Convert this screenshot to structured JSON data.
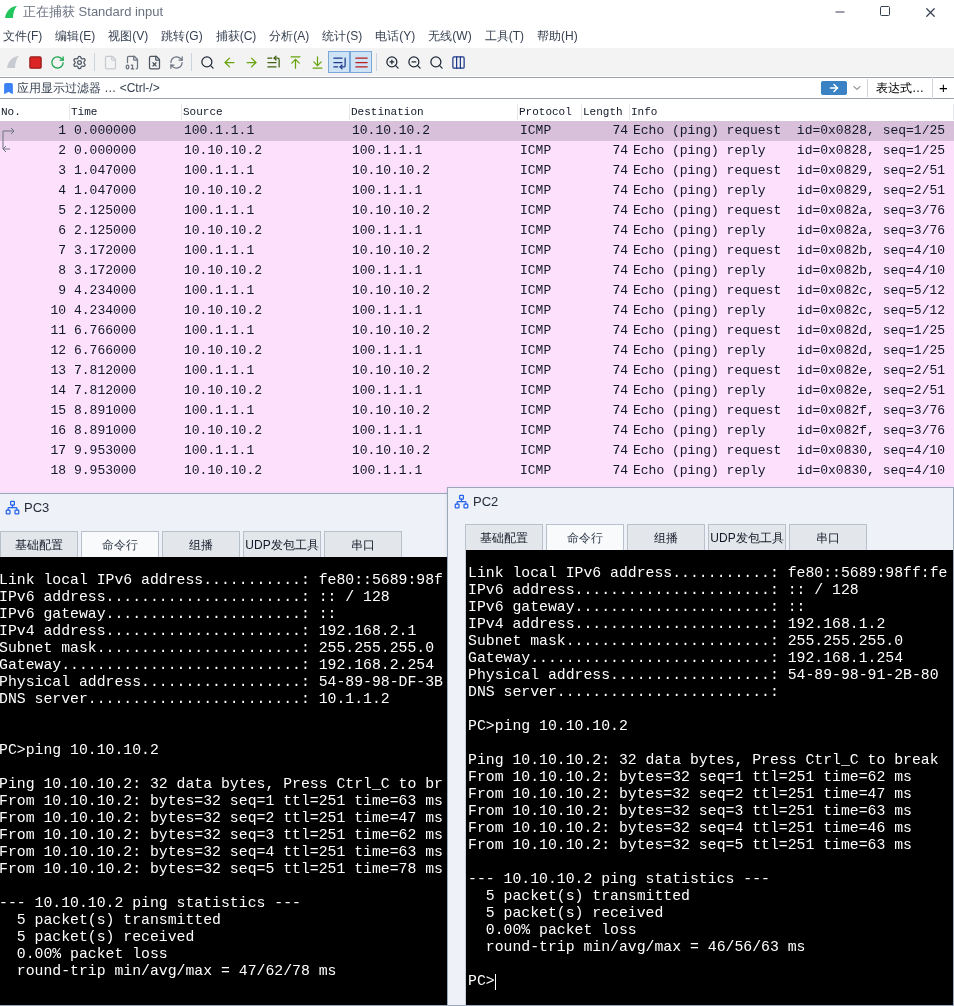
{
  "window": {
    "title": "正在捕获 Standard input"
  },
  "menu": [
    "文件(F)",
    "编辑(E)",
    "视图(V)",
    "跳转(G)",
    "捕获(C)",
    "分析(A)",
    "统计(S)",
    "电话(Y)",
    "无线(W)",
    "工具(T)",
    "帮助(H)"
  ],
  "toolbar": [
    {
      "on": false,
      "disabled": true
    },
    {
      "on": false,
      "disabled": false
    },
    {
      "on": false,
      "disabled": false
    },
    {
      "on": false,
      "disabled": false
    },
    {
      "on": false,
      "disabled": true
    },
    {
      "on": false,
      "disabled": false
    },
    {
      "on": false,
      "disabled": false
    },
    {
      "on": false,
      "disabled": false
    },
    {
      "on": false,
      "disabled": false
    },
    {
      "on": false,
      "disabled": false
    },
    {
      "on": false,
      "disabled": false
    },
    {
      "on": false,
      "disabled": false
    },
    {
      "on": false,
      "disabled": false
    },
    {
      "on": false,
      "disabled": false
    },
    {
      "on": true,
      "disabled": false
    },
    {
      "on": true,
      "disabled": false
    },
    {
      "on": false,
      "disabled": false
    },
    {
      "on": false,
      "disabled": false
    },
    {
      "on": false,
      "disabled": false
    },
    {
      "on": false,
      "disabled": false
    }
  ],
  "filter": {
    "placeholder": "应用显示过滤器 … <Ctrl-/>",
    "expression": "表达式…",
    "add": "+"
  },
  "table": {
    "columns": [
      "No.",
      "Time",
      "Source",
      "Destination",
      "Protocol",
      "Length",
      "Info"
    ],
    "rows": [
      {
        "cells": [
          "1",
          "0.000000",
          "100.1.1.1",
          "10.10.10.2",
          "ICMP",
          "74",
          "Echo (ping) request  id=0x0828, seq=1/25"
        ],
        "selected": true,
        "kind": "request"
      },
      {
        "cells": [
          "2",
          "0.000000",
          "10.10.10.2",
          "100.1.1.1",
          "ICMP",
          "74",
          "Echo (ping) reply    id=0x0828, seq=1/25"
        ],
        "selected": false,
        "kind": "reply"
      },
      {
        "cells": [
          "3",
          "1.047000",
          "100.1.1.1",
          "10.10.10.2",
          "ICMP",
          "74",
          "Echo (ping) request  id=0x0829, seq=2/51"
        ],
        "selected": false
      },
      {
        "cells": [
          "4",
          "1.047000",
          "10.10.10.2",
          "100.1.1.1",
          "ICMP",
          "74",
          "Echo (ping) reply    id=0x0829, seq=2/51"
        ],
        "selected": false
      },
      {
        "cells": [
          "5",
          "2.125000",
          "100.1.1.1",
          "10.10.10.2",
          "ICMP",
          "74",
          "Echo (ping) request  id=0x082a, seq=3/76"
        ],
        "selected": false
      },
      {
        "cells": [
          "6",
          "2.125000",
          "10.10.10.2",
          "100.1.1.1",
          "ICMP",
          "74",
          "Echo (ping) reply    id=0x082a, seq=3/76"
        ],
        "selected": false
      },
      {
        "cells": [
          "7",
          "3.172000",
          "100.1.1.1",
          "10.10.10.2",
          "ICMP",
          "74",
          "Echo (ping) request  id=0x082b, seq=4/10"
        ],
        "selected": false
      },
      {
        "cells": [
          "8",
          "3.172000",
          "10.10.10.2",
          "100.1.1.1",
          "ICMP",
          "74",
          "Echo (ping) reply    id=0x082b, seq=4/10"
        ],
        "selected": false
      },
      {
        "cells": [
          "9",
          "4.234000",
          "100.1.1.1",
          "10.10.10.2",
          "ICMP",
          "74",
          "Echo (ping) request  id=0x082c, seq=5/12"
        ],
        "selected": false
      },
      {
        "cells": [
          "10",
          "4.234000",
          "10.10.10.2",
          "100.1.1.1",
          "ICMP",
          "74",
          "Echo (ping) reply    id=0x082c, seq=5/12"
        ],
        "selected": false
      },
      {
        "cells": [
          "11",
          "6.766000",
          "100.1.1.1",
          "10.10.10.2",
          "ICMP",
          "74",
          "Echo (ping) request  id=0x082d, seq=1/25"
        ],
        "selected": false
      },
      {
        "cells": [
          "12",
          "6.766000",
          "10.10.10.2",
          "100.1.1.1",
          "ICMP",
          "74",
          "Echo (ping) reply    id=0x082d, seq=1/25"
        ],
        "selected": false
      },
      {
        "cells": [
          "13",
          "7.812000",
          "100.1.1.1",
          "10.10.10.2",
          "ICMP",
          "74",
          "Echo (ping) request  id=0x082e, seq=2/51"
        ],
        "selected": false
      },
      {
        "cells": [
          "14",
          "7.812000",
          "10.10.10.2",
          "100.1.1.1",
          "ICMP",
          "74",
          "Echo (ping) reply    id=0x082e, seq=2/51"
        ],
        "selected": false
      },
      {
        "cells": [
          "15",
          "8.891000",
          "100.1.1.1",
          "10.10.10.2",
          "ICMP",
          "74",
          "Echo (ping) request  id=0x082f, seq=3/76"
        ],
        "selected": false
      },
      {
        "cells": [
          "16",
          "8.891000",
          "10.10.10.2",
          "100.1.1.1",
          "ICMP",
          "74",
          "Echo (ping) reply    id=0x082f, seq=3/76"
        ],
        "selected": false
      },
      {
        "cells": [
          "17",
          "9.953000",
          "100.1.1.1",
          "10.10.10.2",
          "ICMP",
          "74",
          "Echo (ping) request  id=0x0830, seq=4/10"
        ],
        "selected": false
      },
      {
        "cells": [
          "18",
          "9.953000",
          "10.10.10.2",
          "100.1.1.1",
          "ICMP",
          "74",
          "Echo (ping) reply    id=0x0830, seq=4/10"
        ],
        "selected": false
      }
    ]
  },
  "pc_windows": [
    {
      "title": "PC3",
      "tabs": [
        {
          "label": "基础配置",
          "selected": false
        },
        {
          "label": "命令行",
          "selected": true
        },
        {
          "label": "组播",
          "selected": false
        },
        {
          "label": "UDP发包工具",
          "selected": false
        },
        {
          "label": "串口",
          "selected": false
        }
      ],
      "cursor": false,
      "blocks": [
        {
          "double_gap": false,
          "lines": [
            "Link local IPv6 address...........: fe80::5689:98f",
            "IPv6 address......................: :: / 128",
            "IPv6 gateway......................: ::",
            "IPv4 address......................: 192.168.2.1",
            "Subnet mask.......................: 255.255.255.0",
            "Gateway...........................: 192.168.2.254",
            "Physical address..................: 54-89-98-DF-3B",
            "DNS server........................: 10.1.1.2"
          ]
        },
        {
          "double_gap": true,
          "lines": [
            "PC>ping 10.10.10.2"
          ]
        },
        {
          "double_gap": false,
          "lines": [
            "Ping 10.10.10.2: 32 data bytes, Press Ctrl_C to br",
            "From 10.10.10.2: bytes=32 seq=1 ttl=251 time=63 ms",
            "From 10.10.10.2: bytes=32 seq=2 ttl=251 time=47 ms",
            "From 10.10.10.2: bytes=32 seq=3 ttl=251 time=62 ms",
            "From 10.10.10.2: bytes=32 seq=4 ttl=251 time=63 ms",
            "From 10.10.10.2: bytes=32 seq=5 ttl=251 time=78 ms"
          ]
        },
        {
          "double_gap": false,
          "lines": [
            "--- 10.10.10.2 ping statistics ---",
            "  5 packet(s) transmitted",
            "  5 packet(s) received",
            "  0.00% packet loss",
            "  round-trip min/avg/max = 47/62/78 ms"
          ]
        }
      ]
    },
    {
      "title": "PC2",
      "tabs": [
        {
          "label": "基础配置",
          "selected": false
        },
        {
          "label": "命令行",
          "selected": true
        },
        {
          "label": "组播",
          "selected": false
        },
        {
          "label": "UDP发包工具",
          "selected": false
        },
        {
          "label": "串口",
          "selected": false
        }
      ],
      "cursor": true,
      "blocks": [
        {
          "double_gap": false,
          "lines": [
            "Link local IPv6 address...........: fe80::5689:98ff:fe",
            "IPv6 address......................: :: / 128",
            "IPv6 gateway......................: ::",
            "IPv4 address......................: 192.168.1.2",
            "Subnet mask.......................: 255.255.255.0",
            "Gateway...........................: 192.168.1.254",
            "Physical address..................: 54-89-98-91-2B-80",
            "DNS server........................:"
          ]
        },
        {
          "double_gap": false,
          "lines": [
            "PC>ping 10.10.10.2"
          ]
        },
        {
          "double_gap": false,
          "lines": [
            "Ping 10.10.10.2: 32 data bytes, Press Ctrl_C to break",
            "From 10.10.10.2: bytes=32 seq=1 ttl=251 time=62 ms",
            "From 10.10.10.2: bytes=32 seq=2 ttl=251 time=47 ms",
            "From 10.10.10.2: bytes=32 seq=3 ttl=251 time=63 ms",
            "From 10.10.10.2: bytes=32 seq=4 ttl=251 time=46 ms",
            "From 10.10.10.2: bytes=32 seq=5 ttl=251 time=63 ms"
          ]
        },
        {
          "double_gap": false,
          "lines": [
            "--- 10.10.10.2 ping statistics ---",
            "  5 packet(s) transmitted",
            "  5 packet(s) received",
            "  0.00% packet loss",
            "  round-trip min/avg/max = 46/56/63 ms"
          ]
        },
        {
          "double_gap": false,
          "lines": [
            "PC>"
          ]
        }
      ]
    }
  ]
}
